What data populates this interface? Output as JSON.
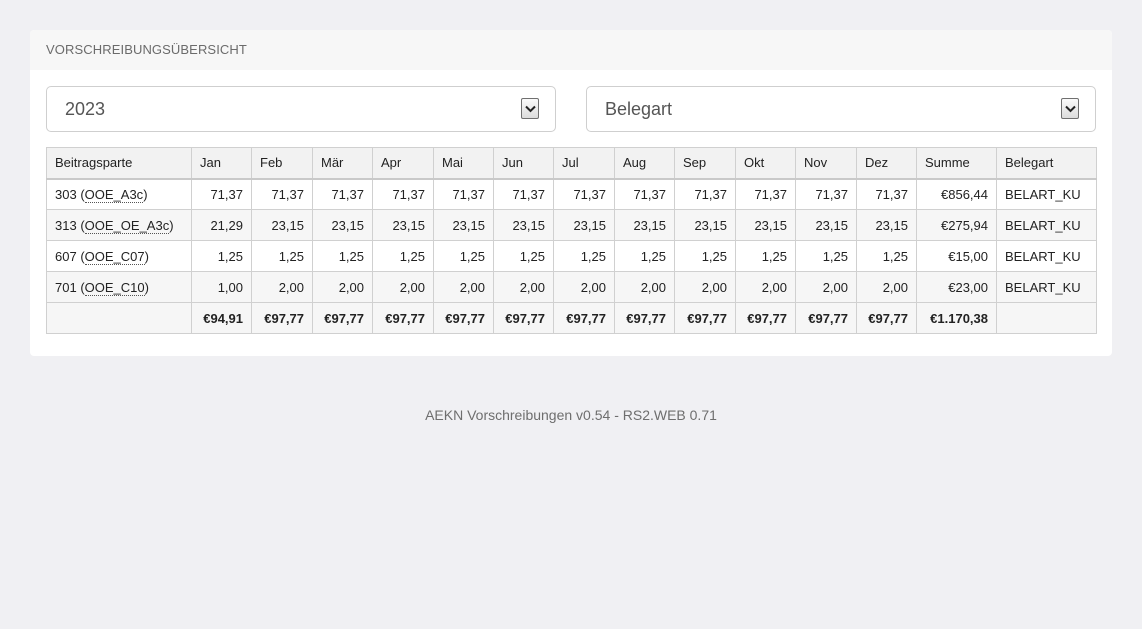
{
  "panel": {
    "title": "VORSCHREIBUNGSÜBERSICHT"
  },
  "filters": {
    "year": {
      "value": "2023"
    },
    "doc_type": {
      "value": "Belegart"
    }
  },
  "table": {
    "headers": [
      "Beitragsparte",
      "Jan",
      "Feb",
      "Mär",
      "Apr",
      "Mai",
      "Jun",
      "Jul",
      "Aug",
      "Sep",
      "Okt",
      "Nov",
      "Dez",
      "Summe",
      "Belegart"
    ],
    "rows": [
      {
        "number": "303",
        "code": "OOE_A3c",
        "months": [
          "71,37",
          "71,37",
          "71,37",
          "71,37",
          "71,37",
          "71,37",
          "71,37",
          "71,37",
          "71,37",
          "71,37",
          "71,37",
          "71,37"
        ],
        "sum": "€856,44",
        "type": "BELART_KU"
      },
      {
        "number": "313",
        "code": "OOE_OE_A3c",
        "months": [
          "21,29",
          "23,15",
          "23,15",
          "23,15",
          "23,15",
          "23,15",
          "23,15",
          "23,15",
          "23,15",
          "23,15",
          "23,15",
          "23,15"
        ],
        "sum": "€275,94",
        "type": "BELART_KU"
      },
      {
        "number": "607",
        "code": "OOE_C07",
        "months": [
          "1,25",
          "1,25",
          "1,25",
          "1,25",
          "1,25",
          "1,25",
          "1,25",
          "1,25",
          "1,25",
          "1,25",
          "1,25",
          "1,25"
        ],
        "sum": "€15,00",
        "type": "BELART_KU"
      },
      {
        "number": "701",
        "code": "OOE_C10",
        "months": [
          "1,00",
          "2,00",
          "2,00",
          "2,00",
          "2,00",
          "2,00",
          "2,00",
          "2,00",
          "2,00",
          "2,00",
          "2,00",
          "2,00"
        ],
        "sum": "€23,00",
        "type": "BELART_KU"
      }
    ],
    "totals": {
      "months": [
        "€94,91",
        "€97,77",
        "€97,77",
        "€97,77",
        "€97,77",
        "€97,77",
        "€97,77",
        "€97,77",
        "€97,77",
        "€97,77",
        "€97,77",
        "€97,77"
      ],
      "sum": "€1.170,38"
    }
  },
  "footer": {
    "version": "AEKN Vorschreibungen v0.54 - RS2.WEB 0.71"
  },
  "icons": {
    "dropdown": "chevron-down-icon"
  }
}
